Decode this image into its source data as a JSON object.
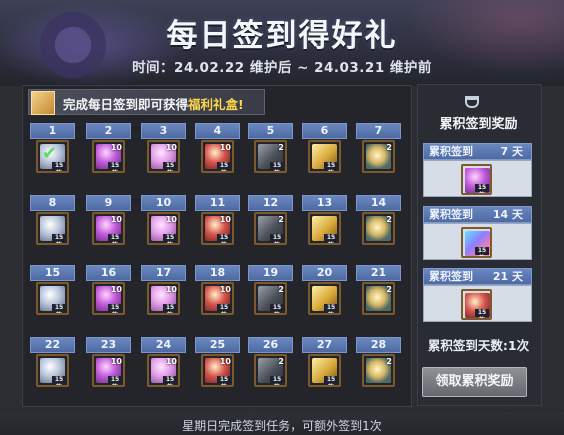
{
  "banner": {
    "title": "每日签到得好礼",
    "subtitle": "时间：24.02.22 维护后 ~ 24.03.21 维护前"
  },
  "notice": {
    "prefix": "完成每日签到即可获得",
    "highlight": "福利礼盒!",
    "icon": "gift-box-icon"
  },
  "days": [
    {
      "label": "1",
      "item": "silver",
      "stack": "",
      "badge": "15款",
      "checked": true
    },
    {
      "label": "2",
      "item": "purple",
      "stack": "10",
      "badge": "15款",
      "checked": false
    },
    {
      "label": "3",
      "item": "pink",
      "stack": "10",
      "badge": "15款",
      "checked": false
    },
    {
      "label": "4",
      "item": "red",
      "stack": "10",
      "badge": "15款",
      "checked": false
    },
    {
      "label": "5",
      "item": "dark",
      "stack": "2",
      "badge": "15款",
      "checked": false
    },
    {
      "label": "6",
      "item": "gold",
      "stack": "",
      "badge": "15款",
      "checked": false
    },
    {
      "label": "7",
      "item": "coin",
      "stack": "2",
      "badge": "",
      "checked": false
    },
    {
      "label": "8",
      "item": "silver",
      "stack": "",
      "badge": "15款",
      "checked": false
    },
    {
      "label": "9",
      "item": "purple",
      "stack": "10",
      "badge": "15款",
      "checked": false
    },
    {
      "label": "10",
      "item": "pink",
      "stack": "10",
      "badge": "15款",
      "checked": false
    },
    {
      "label": "11",
      "item": "red",
      "stack": "10",
      "badge": "15款",
      "checked": false
    },
    {
      "label": "12",
      "item": "dark",
      "stack": "2",
      "badge": "15款",
      "checked": false
    },
    {
      "label": "13",
      "item": "gold",
      "stack": "",
      "badge": "15款",
      "checked": false
    },
    {
      "label": "14",
      "item": "coin",
      "stack": "2",
      "badge": "",
      "checked": false
    },
    {
      "label": "15",
      "item": "silver",
      "stack": "",
      "badge": "15款",
      "checked": false
    },
    {
      "label": "16",
      "item": "purple",
      "stack": "10",
      "badge": "15款",
      "checked": false
    },
    {
      "label": "17",
      "item": "pink",
      "stack": "10",
      "badge": "15款",
      "checked": false
    },
    {
      "label": "18",
      "item": "red",
      "stack": "10",
      "badge": "15款",
      "checked": false
    },
    {
      "label": "19",
      "item": "dark",
      "stack": "2",
      "badge": "15款",
      "checked": false
    },
    {
      "label": "20",
      "item": "gold",
      "stack": "",
      "badge": "15款",
      "checked": false
    },
    {
      "label": "21",
      "item": "coin",
      "stack": "2",
      "badge": "",
      "checked": false
    },
    {
      "label": "22",
      "item": "silver",
      "stack": "",
      "badge": "15款",
      "checked": false
    },
    {
      "label": "23",
      "item": "purple",
      "stack": "10",
      "badge": "15款",
      "checked": false
    },
    {
      "label": "24",
      "item": "pink",
      "stack": "10",
      "badge": "15款",
      "checked": false
    },
    {
      "label": "25",
      "item": "red",
      "stack": "10",
      "badge": "15款",
      "checked": false
    },
    {
      "label": "26",
      "item": "dark",
      "stack": "2",
      "badge": "15款",
      "checked": false
    },
    {
      "label": "27",
      "item": "gold",
      "stack": "",
      "badge": "15款",
      "checked": false
    },
    {
      "label": "28",
      "item": "coin",
      "stack": "2",
      "badge": "",
      "checked": false
    }
  ],
  "cumulative": {
    "title": "累积签到奖励",
    "icon": "trophy-icon",
    "rewards": [
      {
        "label": "累积签到",
        "days": "7 天",
        "item": "purple",
        "badge": "15款"
      },
      {
        "label": "累积签到",
        "days": "14 天",
        "item": "rainbow",
        "badge": "15款"
      },
      {
        "label": "累积签到",
        "days": "21 天",
        "item": "red",
        "badge": "15款"
      }
    ],
    "total_days": "累积签到天数:1次",
    "claim_button": "领取累积奖励"
  },
  "footer": {
    "text": "星期日完成签到任务，可额外签到1次"
  },
  "colors": {
    "accent_blue": "#5d79b3",
    "highlight_yellow": "#ffd54d",
    "check_green": "#57e060"
  }
}
